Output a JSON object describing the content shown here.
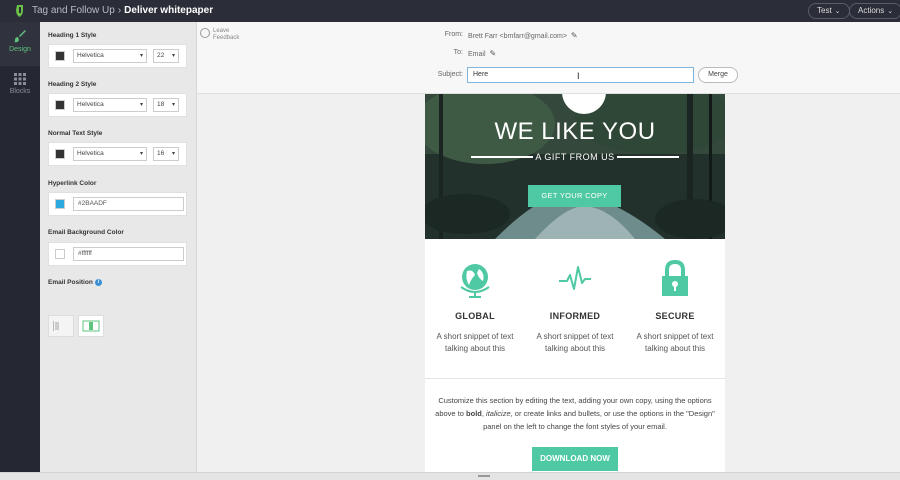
{
  "topbar": {
    "breadcrumb_parent": "Tag and Follow Up",
    "breadcrumb_sep": "›",
    "breadcrumb_current": "Deliver whitepaper",
    "test_label": "Test",
    "actions_label": "Actions",
    "caret": "⌄"
  },
  "rail": {
    "design_label": "Design",
    "blocks_label": "Blocks"
  },
  "panel": {
    "heading1_label": "Heading 1 Style",
    "heading1_font": "Helvetica",
    "heading1_size": "22",
    "heading2_label": "Heading 2 Style",
    "heading2_font": "Helvetica",
    "heading2_size": "18",
    "normal_label": "Normal Text Style",
    "normal_font": "Helvetica",
    "normal_size": "16",
    "hyperlink_label": "Hyperlink Color",
    "hyperlink_value": "#2BAADF",
    "bg_label": "Email Background Color",
    "bg_value": "#ffffff",
    "position_label": "Email Position",
    "info_glyph": "i"
  },
  "colors": {
    "text_swatch": "#333333",
    "hyperlink": "#2BAADF",
    "accent": "#4fc9a3",
    "active_green": "#5fc37e"
  },
  "feedback": {
    "line1": "Leave",
    "line2": "Feedback"
  },
  "header": {
    "from_label": "From:",
    "from_value": "Brett Farr <bmfarr@gmail.com>",
    "to_label": "To:",
    "to_value": "Email",
    "subject_label": "Subject:",
    "subject_value": "Here",
    "merge_label": "Merge",
    "pencil": "✎"
  },
  "email": {
    "hero_title": "WE LIKE YOU",
    "hero_sub": "A GIFT FROM US",
    "hero_button": "GET YOUR COPY",
    "features": [
      {
        "icon": "globe-icon",
        "title": "GLOBAL",
        "desc": "A short snippet of text talking about this"
      },
      {
        "icon": "pulse-icon",
        "title": "INFORMED",
        "desc": "A short snippet of text talking about this"
      },
      {
        "icon": "lock-icon",
        "title": "SECURE",
        "desc": "A short snippet of text talking about this"
      }
    ],
    "body_a": "Customize this section by editing the text, adding your own copy, using the options above to ",
    "body_bold": "bold",
    "body_b": ", ",
    "body_italic": "italicize",
    "body_c": ", or create links and bullets, or use the options in the \"Design\" panel on the left to change the font styles of your email.",
    "download_label": "DOWNLOAD NOW"
  }
}
